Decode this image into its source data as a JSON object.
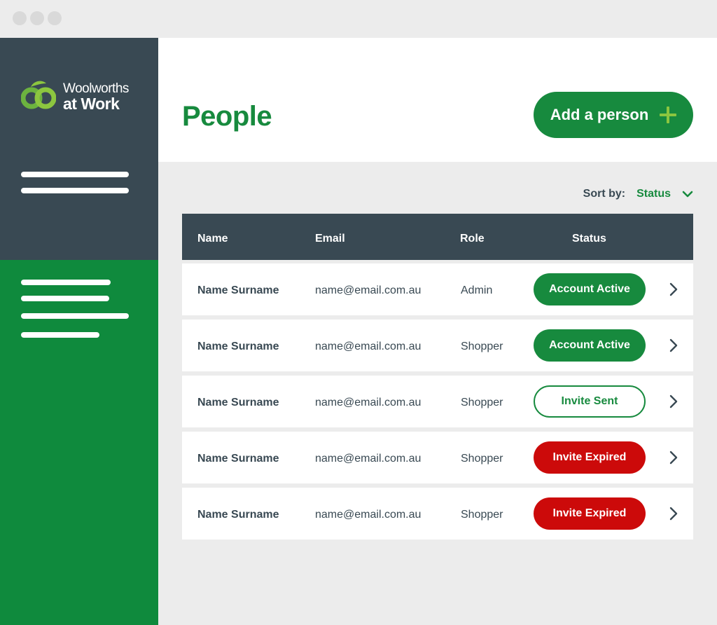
{
  "brand": {
    "name_line1": "Woolworths",
    "name_line2": "at Work",
    "logo_icon": "woolworths-logo-icon"
  },
  "colors": {
    "brand_green": "#178a3e",
    "light_green": "#8cc63f",
    "sidebar_dark": "#394953",
    "sidebar_green": "#0f8a3d",
    "expired_red": "#cc0a0a"
  },
  "header": {
    "title": "People",
    "add_button_label": "Add a person",
    "add_button_icon": "plus-icon"
  },
  "sort": {
    "label": "Sort by:",
    "value": "Status",
    "icon": "chevron-down-icon"
  },
  "table": {
    "columns": [
      "Name",
      "Email",
      "Role",
      "Status"
    ],
    "rows": [
      {
        "name": "Name Surname",
        "email": "name@email.com.au",
        "role": "Admin",
        "status": "Account Active"
      },
      {
        "name": "Name Surname",
        "email": "name@email.com.au",
        "role": "Shopper",
        "status": "Account Active"
      },
      {
        "name": "Name Surname",
        "email": "name@email.com.au",
        "role": "Shopper",
        "status": "Invite Sent"
      },
      {
        "name": "Name Surname",
        "email": "name@email.com.au",
        "role": "Shopper",
        "status": "Invite Expired"
      },
      {
        "name": "Name Surname",
        "email": "name@email.com.au",
        "role": "Shopper",
        "status": "Invite Expired"
      }
    ]
  }
}
